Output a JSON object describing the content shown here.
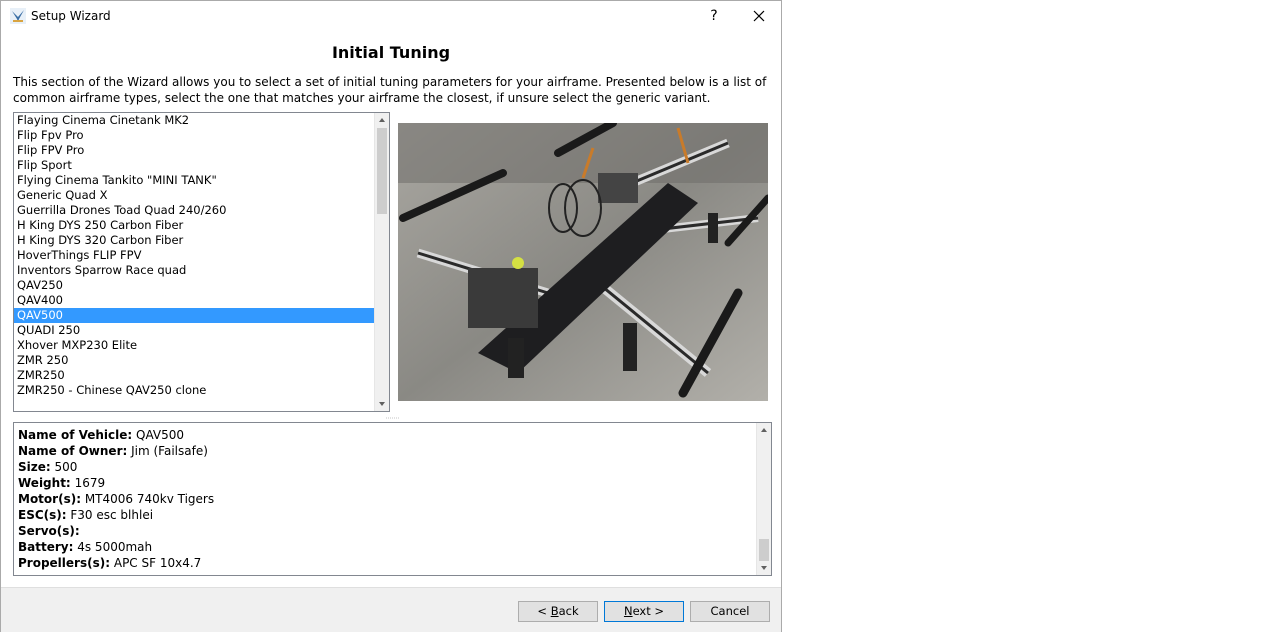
{
  "window": {
    "title": "Setup Wizard",
    "help_label": "?"
  },
  "page": {
    "heading": "Initial Tuning",
    "description": "This section of the Wizard allows you to select a set of initial tuning parameters for your airframe. Presented below is a list of common airframe types, select the one that matches your airframe the closest, if unsure select the generic variant."
  },
  "airframes": {
    "items": [
      "Flaying Cinema Cinetank MK2",
      "Flip Fpv Pro",
      "Flip FPV Pro",
      "Flip Sport",
      "Flying Cinema Tankito \"MINI TANK\"",
      "Generic Quad X",
      "Guerrilla Drones Toad Quad 240/260",
      "H King DYS 250 Carbon Fiber",
      "H King DYS 320 Carbon Fiber",
      "HoverThings FLIP FPV",
      "Inventors Sparrow Race quad",
      "QAV250",
      "QAV400",
      "QAV500",
      "QUADI 250",
      "Xhover MXP230 Elite",
      "ZMR 250",
      "ZMR250",
      "ZMR250 - Chinese QAV250 clone"
    ],
    "selected_index": 13
  },
  "details": [
    {
      "label": "Name of Vehicle:",
      "value": "QAV500"
    },
    {
      "label": "Name of Owner:",
      "value": "Jim (Failsafe)"
    },
    {
      "label": "Size:",
      "value": "500"
    },
    {
      "label": "Weight:",
      "value": "1679"
    },
    {
      "label": "Motor(s):",
      "value": "MT4006 740kv Tigers"
    },
    {
      "label": "ESC(s):",
      "value": "F30 esc blhlei"
    },
    {
      "label": "Servo(s):",
      "value": ""
    },
    {
      "label": "Battery:",
      "value": "4s 5000mah"
    },
    {
      "label": "Propellers(s):",
      "value": "APC SF 10x4.7"
    }
  ],
  "buttons": {
    "back": {
      "mnemonic": "B",
      "rest": "ack",
      "prefix": "< "
    },
    "next": {
      "mnemonic": "N",
      "rest": "ext >",
      "prefix": ""
    },
    "cancel": "Cancel"
  },
  "colors": {
    "selection": "#3399ff",
    "default_button_border": "#0078d7"
  }
}
